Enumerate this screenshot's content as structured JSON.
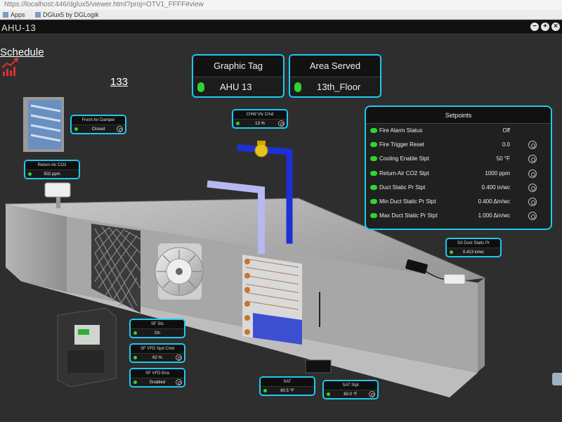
{
  "browser": {
    "url": "https://localhost:446/dglux5/viewer.html?proj=OTV1_FFFF#view",
    "bookmarks": [
      "Apps",
      "DGlux5 by DGLogik"
    ]
  },
  "window": {
    "title": "AHU-13",
    "buttons": [
      "−",
      "+",
      "×"
    ]
  },
  "nav": {
    "schedule_link": "Schedule",
    "unit_number": "133"
  },
  "graphic_tag": {
    "header": "Graphic Tag",
    "value": "AHU 13"
  },
  "area_served": {
    "header": "Area Served",
    "value": "13th_Floor"
  },
  "widgets": {
    "fresh_air_damper": {
      "label": "Fresh Air Damper",
      "value": "Closed"
    },
    "return_air_co2": {
      "label": "Return Air CO2",
      "value": "502 ppm"
    },
    "chw_vlv_cmd": {
      "label": "CHW Vlv Cmd",
      "value": "13 %"
    },
    "sa_duct_static_pr": {
      "label": "SA Duct Static Pr",
      "value": "0.413 in/wc"
    },
    "sf_sts": {
      "label": "SF Sts",
      "value": "On"
    },
    "sf_vfd_spd_cmd": {
      "label": "SF VFD Spd Cmd",
      "value": "62 %"
    },
    "sf_vfd_ena": {
      "label": "SF VFD Ena",
      "value": "Enabled"
    },
    "sat": {
      "label": "SAT",
      "value": "60.5 °F"
    },
    "sat_stpt": {
      "label": "SAT Stpt",
      "value": "60.0 °F"
    }
  },
  "setpoints": {
    "title": "Setpoints",
    "rows": [
      {
        "label": "Fire Alarm Status",
        "value": "Off",
        "editable": false
      },
      {
        "label": "Fire Trigger Reset",
        "value": "0.0",
        "editable": true
      },
      {
        "label": "Cooling Enable Stpt",
        "value": "50 °F",
        "editable": true
      },
      {
        "label": "Return Air CO2 Stpt",
        "value": "1000 ppm",
        "editable": true
      },
      {
        "label": "Duct Static Pr Stpt",
        "value": "0.400 in/wc",
        "editable": true
      },
      {
        "label": "Min Duct Static Pr Stpt",
        "value": "0.400 Δin/wc",
        "editable": true
      },
      {
        "label": "Max Duct Static Pr Stpt",
        "value": "1.000 Δin/wc",
        "editable": true
      }
    ]
  },
  "colors": {
    "accent": "#1ec8f0",
    "status_ok": "#2dd62d",
    "background": "#2e2e2e",
    "trend_icon": "#e03030"
  },
  "icons": [
    "trend-chart-icon",
    "status-dot-icon",
    "settings-icon"
  ]
}
